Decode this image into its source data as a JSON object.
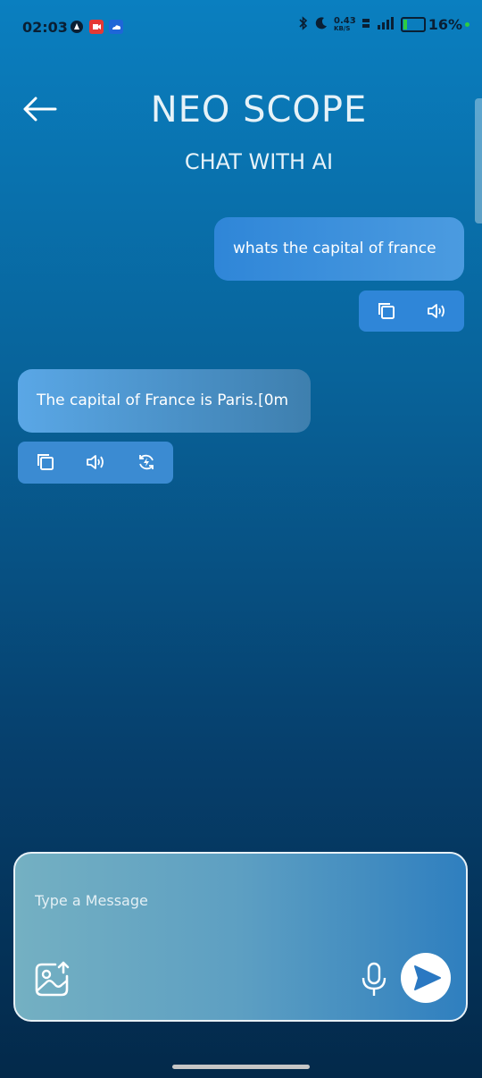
{
  "status_bar": {
    "time": "02:03",
    "network_speed": "0.43",
    "network_unit": "KB/S",
    "battery": "16%",
    "battery_color": "#2ecc40"
  },
  "header": {
    "title": "NEO SCOPE",
    "subtitle": "CHAT WITH AI",
    "back_icon": "arrow-left-icon"
  },
  "chat": {
    "messages": [
      {
        "role": "user",
        "text": "whats the capital of france",
        "actions": [
          "copy-icon",
          "speaker-icon"
        ]
      },
      {
        "role": "ai",
        "text": "The capital of France is Paris.[0m",
        "actions": [
          "copy-icon",
          "speaker-icon",
          "regenerate-icon"
        ]
      }
    ]
  },
  "composer": {
    "placeholder": "Type a Message",
    "value": "",
    "icons": [
      "image-upload-icon",
      "mic-icon",
      "send-icon"
    ]
  },
  "colors": {
    "accent": "#2f86d8",
    "background_top": "#0a7fc0",
    "background_bottom": "#03294a"
  }
}
